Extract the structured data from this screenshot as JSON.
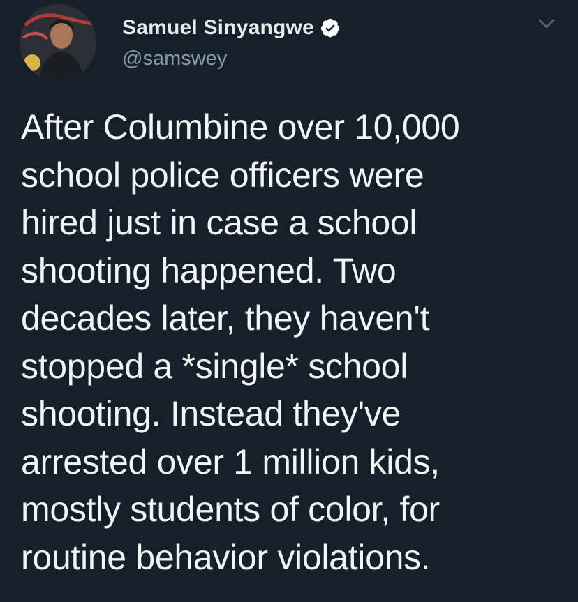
{
  "author": {
    "display_name": "Samuel Sinyangwe",
    "handle": "@samswey",
    "verified": true
  },
  "icons": {
    "verified": "verified-badge-icon",
    "menu": "chevron-down-icon"
  },
  "tweet": {
    "lines": [
      "After Columbine over 10,000",
      "school police officers were",
      "hired just in case a school",
      "shooting happened. Two",
      "decades later, they haven't",
      "stopped a *single* school",
      "shooting. Instead they've",
      "arrested over 1 million kids,",
      "mostly students of color, for",
      "routine behavior violations."
    ]
  },
  "colors": {
    "background": "#16202b",
    "text": "#f1f3f4",
    "secondary": "#8899a6"
  }
}
